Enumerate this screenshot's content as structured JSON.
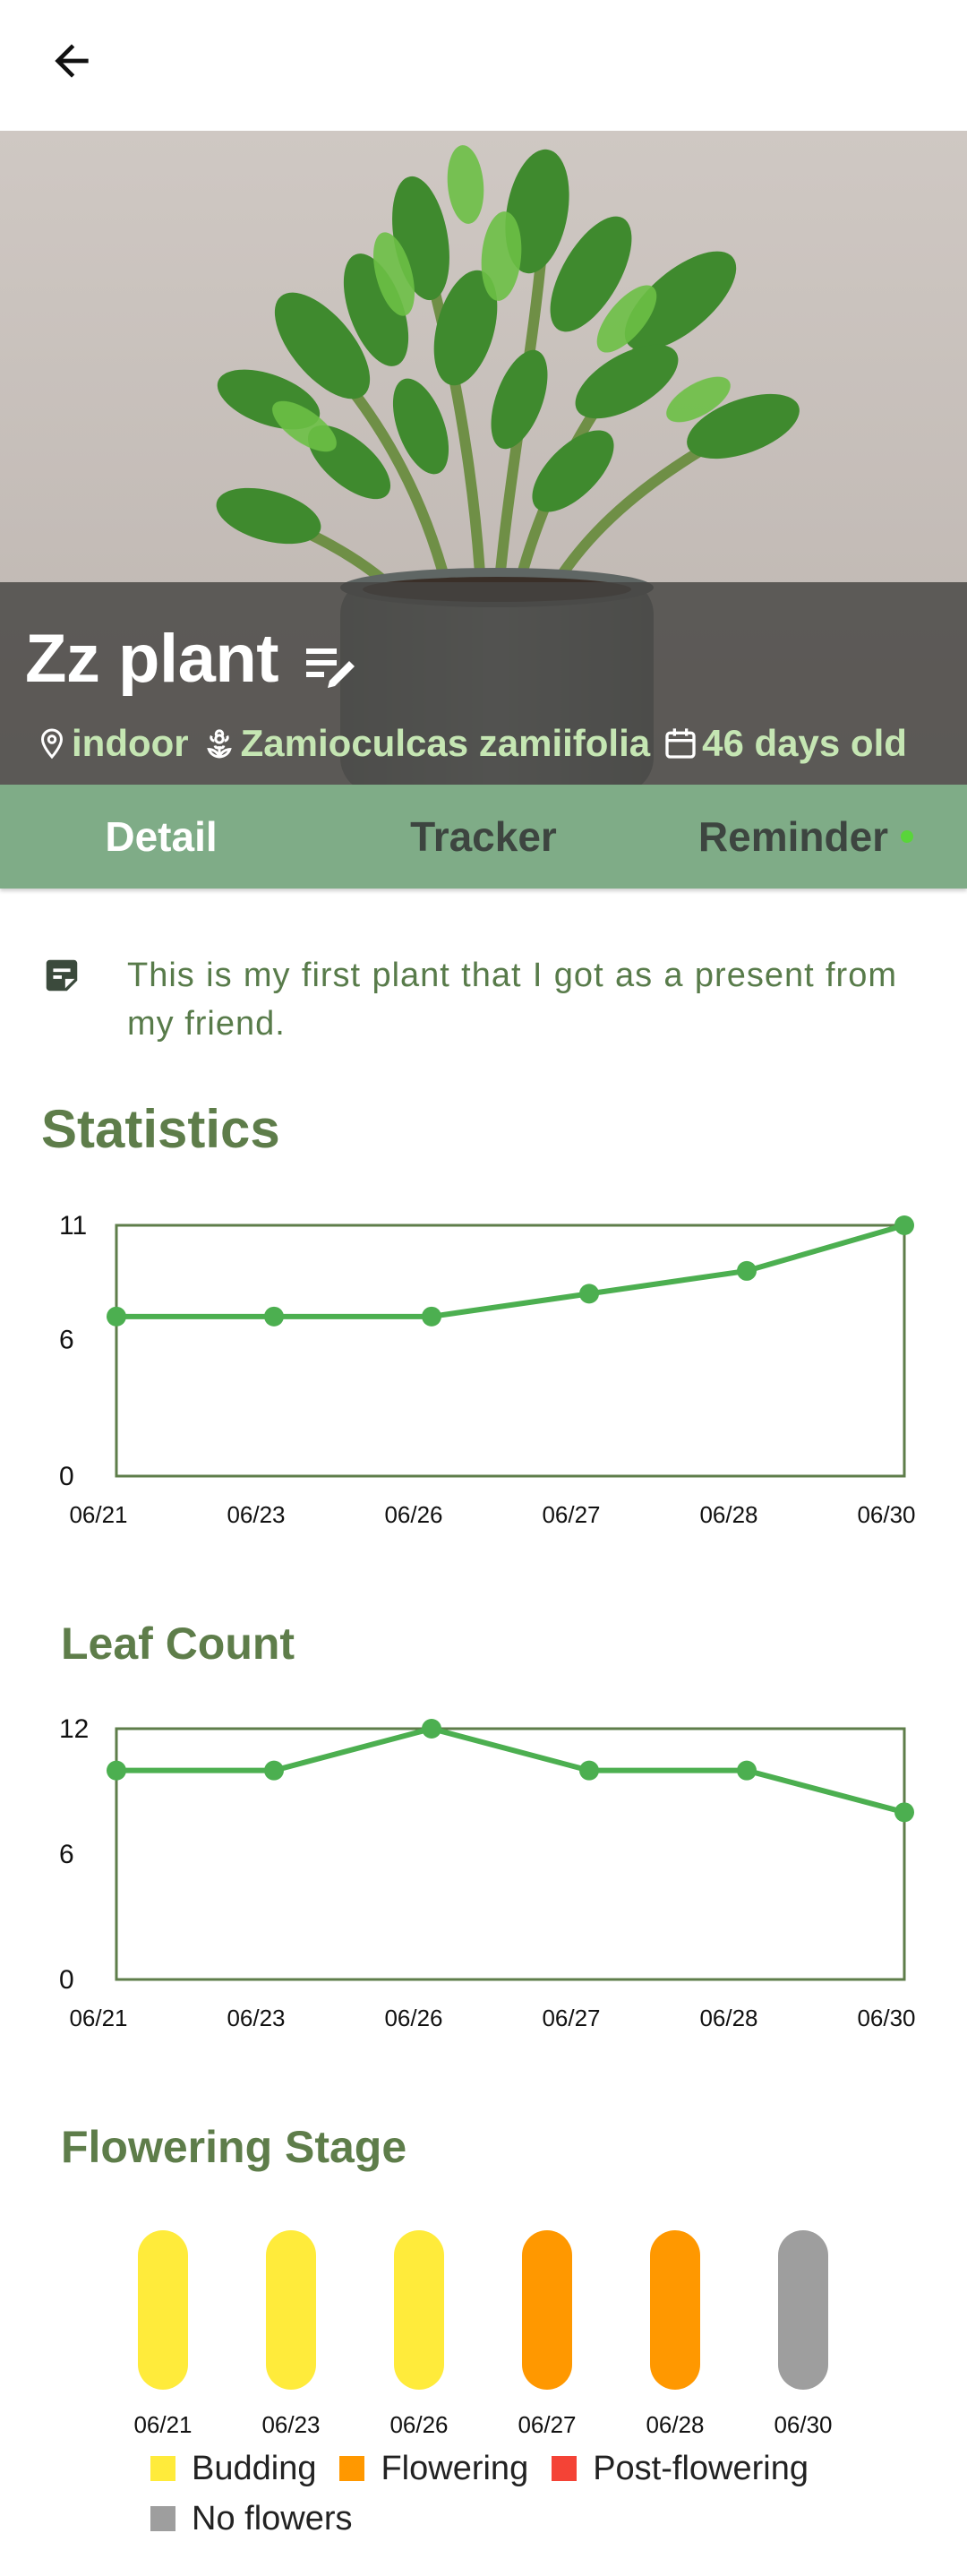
{
  "header": {
    "back_icon": "arrow-left-icon"
  },
  "plant": {
    "name": "Zz plant",
    "location": "indoor",
    "species": "Zamioculcas zamiifolia",
    "age": "46 days old"
  },
  "tabs": [
    {
      "label": "Detail",
      "active": true
    },
    {
      "label": "Tracker",
      "active": false
    },
    {
      "label": "Reminder",
      "active": false,
      "has_dot": true
    }
  ],
  "note": {
    "icon": "note-icon",
    "text": "This is my first plant that I got as a present from my friend."
  },
  "statistics": {
    "title": "Statistics"
  },
  "leaf_count": {
    "title": "Leaf Count"
  },
  "flowering": {
    "title": "Flowering Stage"
  },
  "colors": {
    "line": "#4caf50",
    "frame": "#5e7d4a",
    "budding": "#ffeb3b",
    "flowering": "#ff9800",
    "post_flowering": "#f44336",
    "no_flowers": "#9e9e9e",
    "tab_bar": "#7fac87",
    "title": "#5e7d4a"
  },
  "chart_data": [
    {
      "type": "line",
      "categories": [
        "06/21",
        "06/23",
        "06/26",
        "06/27",
        "06/28",
        "06/30"
      ],
      "yticks": [
        "11",
        "6",
        "0"
      ],
      "ylim": [
        0,
        11
      ],
      "values": [
        7,
        7,
        7,
        8,
        9,
        11
      ],
      "grid": false
    },
    {
      "type": "line",
      "title": "Leaf Count",
      "categories": [
        "06/21",
        "06/23",
        "06/26",
        "06/27",
        "06/28",
        "06/30"
      ],
      "yticks": [
        "12",
        "6",
        "0"
      ],
      "ylim": [
        0,
        12
      ],
      "values": [
        10,
        10,
        12,
        10,
        10,
        8
      ],
      "grid": false
    },
    {
      "type": "bar",
      "title": "Flowering Stage",
      "categories": [
        "06/21",
        "06/23",
        "06/26",
        "06/27",
        "06/28",
        "06/30"
      ],
      "stages": [
        "Budding",
        "Budding",
        "Budding",
        "Flowering",
        "Flowering",
        "No flowers"
      ],
      "legend": [
        "Budding",
        "Flowering",
        "Post-flowering",
        "No flowers"
      ],
      "legend_placement": "bottom"
    }
  ]
}
